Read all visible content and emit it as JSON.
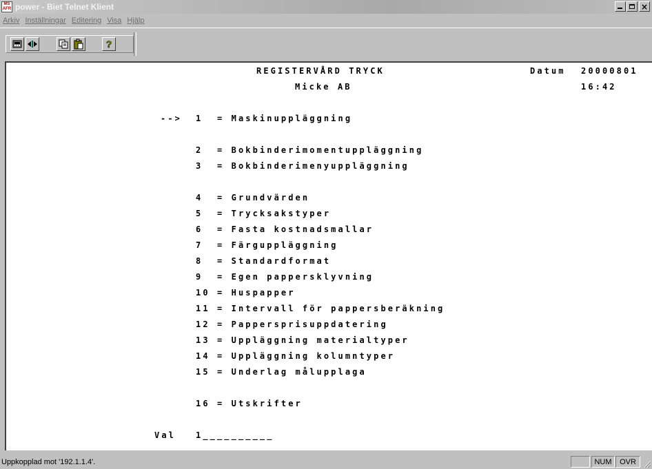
{
  "window": {
    "title": "power - Biet Telnet Klient",
    "app_icon_label": "MS AFR",
    "min_glyph": "",
    "close_glyph": "×"
  },
  "menu": {
    "items": [
      {
        "label": "Arkiv"
      },
      {
        "label": "Inställningar"
      },
      {
        "label": "Editering"
      },
      {
        "label": "Visa"
      },
      {
        "label": "Hjälp"
      }
    ]
  },
  "toolbar": {
    "icons": [
      "terminal-icon",
      "connect-icon",
      "copy-icon",
      "paste-icon",
      "help-icon"
    ]
  },
  "terminal": {
    "header_title": "REGISTERVÅRD TRYCK",
    "company": "Micke AB",
    "date_label": "Datum",
    "date_value": "20000801",
    "time": "16:42",
    "menu_items": [
      {
        "line": "-->",
        "text": "1  = Maskinuppläggning"
      },
      {
        "text": "2  = Bokbinderimomentuppläggning"
      },
      {
        "text": "3  = Bokbinderimenyuppläggning"
      },
      {
        "text": "4  = Grundvärden"
      },
      {
        "text": "5  = Trycksakstyper"
      },
      {
        "text": "6  = Fasta kostnadsmallar"
      },
      {
        "text": "7  = Färguppläggning"
      },
      {
        "text": "8  = Standardformat"
      },
      {
        "text": "9  = Egen pappersklyvning"
      },
      {
        "text": "10 = Huspapper"
      },
      {
        "text": "11 = Intervall för pappersberäkning"
      },
      {
        "text": "12 = Pappersprisuppdatering"
      },
      {
        "text": "13 = Uppläggning materialtyper"
      },
      {
        "text": "14 = Uppläggning kolumntyper"
      },
      {
        "text": "15 = Underlag målupplaga"
      },
      {
        "text": "16 = Utskrifter"
      }
    ],
    "prompt_label": "Val",
    "prompt_value": "1__________"
  },
  "status": {
    "text": "Uppkopplad mot '192.1.1.4'.",
    "panels": [
      "",
      "NUM",
      "OVR"
    ]
  },
  "colors": {
    "terminal_bg": "#ffffff",
    "terminal_fg": "#000000",
    "chrome": "#c0c0c0"
  }
}
